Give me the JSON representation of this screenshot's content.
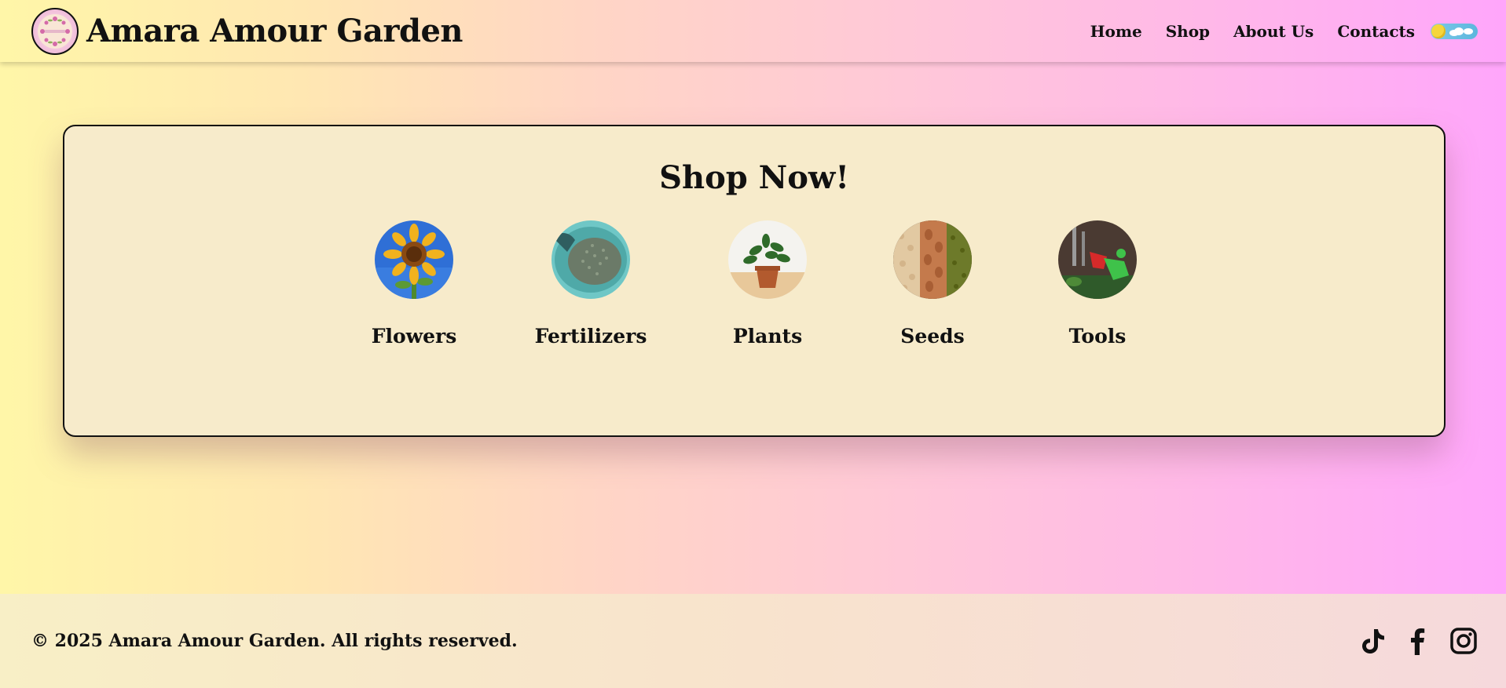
{
  "header": {
    "site_title": "Amara Amour Garden",
    "logo_icon": "flower-wreath-logo",
    "nav": [
      {
        "label": "Home"
      },
      {
        "label": "Shop"
      },
      {
        "label": "About Us"
      },
      {
        "label": "Contacts"
      }
    ],
    "theme_toggle": {
      "state": "light",
      "icon": "sun-icon"
    }
  },
  "shop": {
    "title": "Shop Now!",
    "categories": [
      {
        "label": "Flowers",
        "image": "sunflower-photo"
      },
      {
        "label": "Fertilizers",
        "image": "fertilizer-granules-photo"
      },
      {
        "label": "Plants",
        "image": "potted-plant-photo"
      },
      {
        "label": "Seeds",
        "image": "seeds-photo"
      },
      {
        "label": "Tools",
        "image": "garden-tools-photo"
      }
    ]
  },
  "footer": {
    "copyright": "© 2025 Amara Amour Garden. All rights reserved.",
    "socials": [
      {
        "icon": "tiktok-icon"
      },
      {
        "icon": "facebook-icon"
      },
      {
        "icon": "instagram-icon"
      }
    ]
  },
  "colors": {
    "card_bg": "#f7ebcb",
    "text": "#111111",
    "gradient_left": "#fff6a8",
    "gradient_right": "#ffa6fb"
  }
}
